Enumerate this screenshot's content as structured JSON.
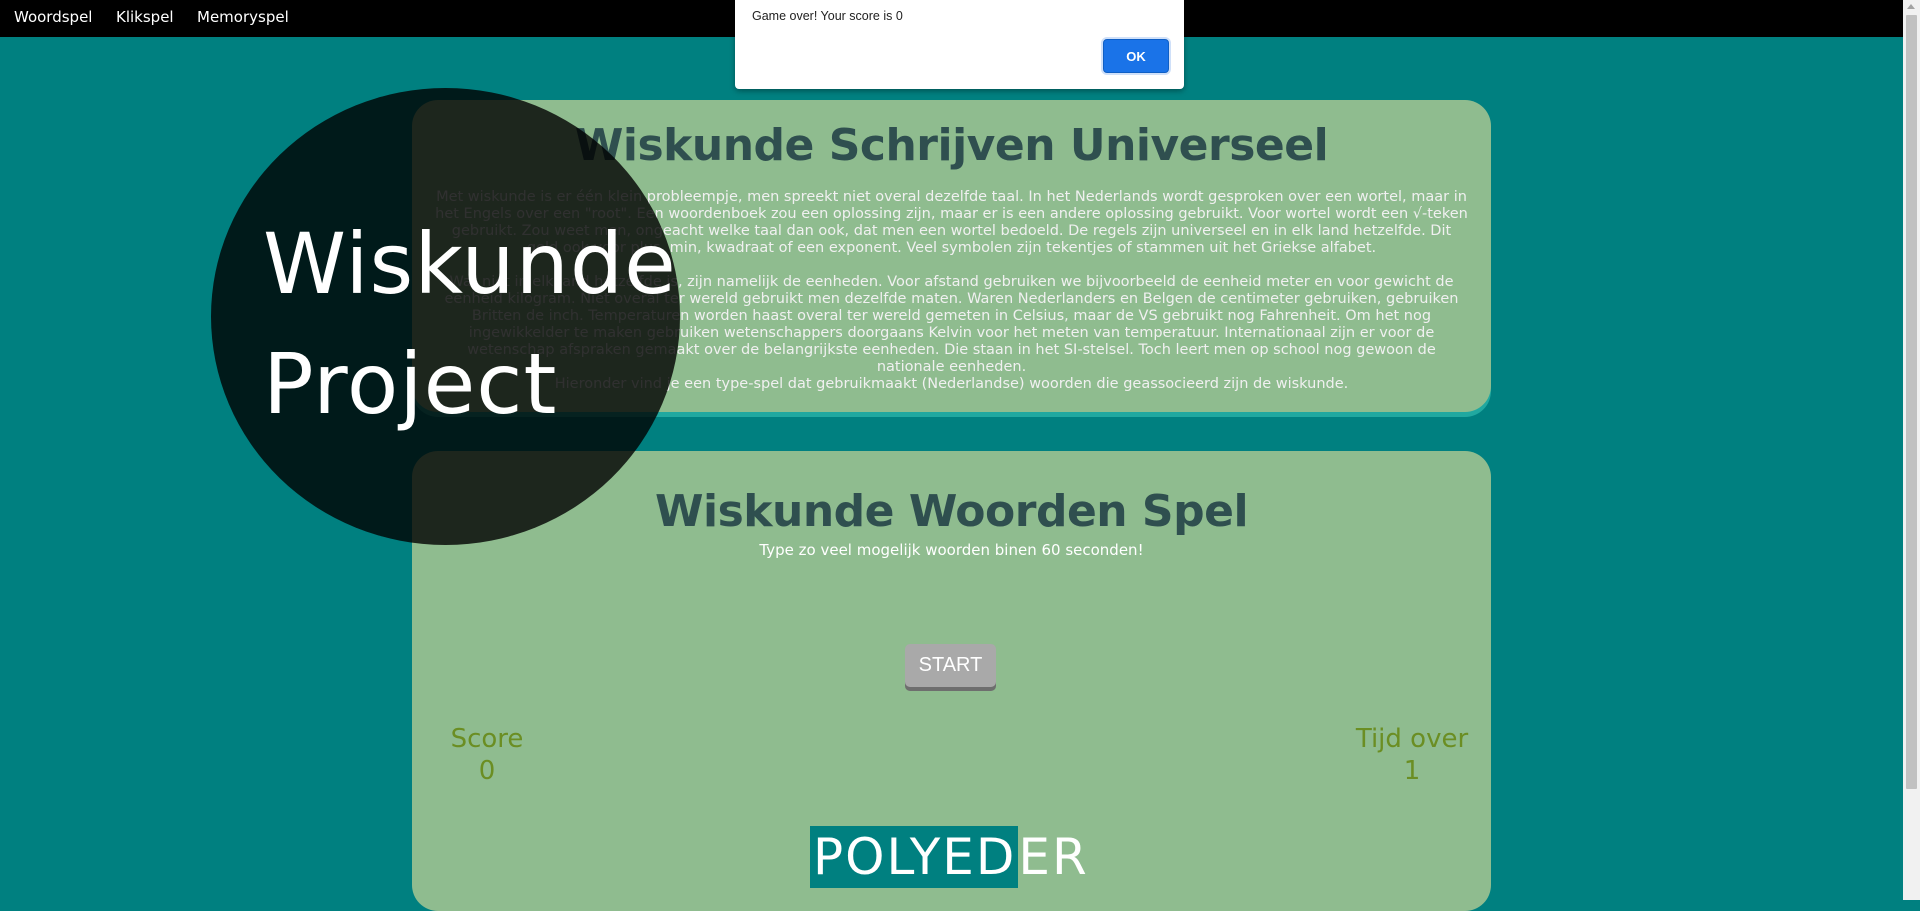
{
  "nav": {
    "items": [
      "Woordspel",
      "Klikspel",
      "Memoryspel"
    ]
  },
  "intro_card": {
    "title": "Wiskunde Schrijven Universeel",
    "paragraphs": [
      "Met wiskunde is er één klein probleempje, men spreekt niet overal dezelfde taal. In het Nederlands wordt gesproken over een wortel, maar in het Engels over een \"root\". Een woordenboek zou een oplossing zijn, maar er is een andere oplossing gebruikt. Voor wortel wordt een √-teken gebruikt. Zou weet men, ongeacht welke taal dan ook, dat men een wortel bedoeld. De regels zijn universeel en in elk land hetzelfde. Dit geld ook voor plus, min, kwadraat of een exponent. Veel symbolen zijn tekentjes of stammen uit het Griekse alfabet.",
      "Wat niet in elk land hetzelfde is, zijn namelijk de eenheden. Voor afstand gebruiken we bijvoorbeeld de eenheid meter en voor gewicht de eenheid kilogram. Niet overal ter wereld gebruikt men dezelfde maten. Waren Nederlanders en Belgen de centimeter gebruiken, gebruiken Britten de inch. Temperaturen worden haast overal ter wereld gemeten in Celsius, maar de VS gebruikt nog Fahrenheit. Om het nog ingewikkelder te maken gebruiken wetenschappers doorgaans Kelvin voor het meten van temperatuur. Internationaal zijn er voor de wetenschap afspraken gemaakt over de belangrijkste eenheden. Die staan in het SI-stelsel. Toch leert men op school nog gewoon de nationale eenheden.",
      "Hieronder vind je een type-spel dat gebruikmaakt (Nederlandse) woorden die geassocieerd zijn de wiskunde."
    ]
  },
  "game_card": {
    "title": "Wiskunde Woorden Spel",
    "subtitle": "Type zo veel mogelijk woorden binen 60 seconden!",
    "start_label": "START",
    "score_label": "Score",
    "score_value": "0",
    "time_label": "Tijd over",
    "time_value": "1",
    "word_typed": "POLYED",
    "word_rest": "ER"
  },
  "overlay": {
    "line1": "Wiskunde",
    "line2": "Project"
  },
  "alert": {
    "message": "Game over! Your score is 0",
    "ok_label": "OK"
  },
  "colors": {
    "page_background": "#008080",
    "card_background": "#8fbc8f",
    "title_color": "#2f4f4f",
    "stat_color": "#6b8e23",
    "alert_button": "#1a73e8"
  }
}
